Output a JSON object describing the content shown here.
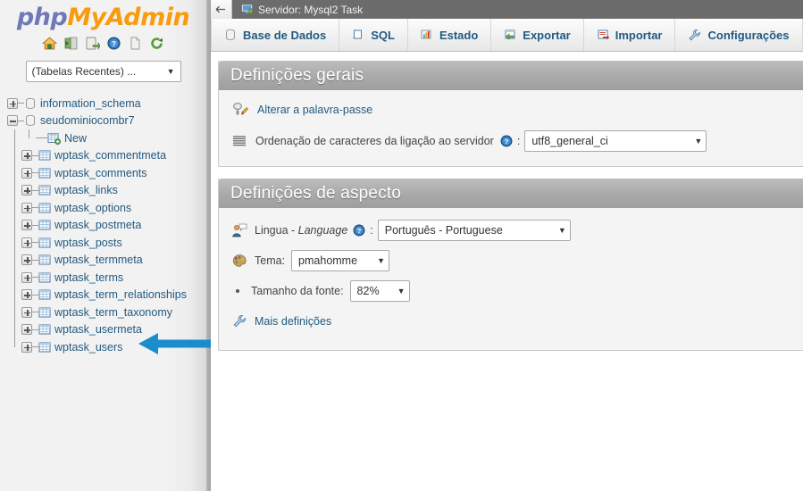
{
  "sidebar": {
    "logo": {
      "php": "php",
      "my": "My",
      "admin": "Admin"
    },
    "nav_icons": [
      {
        "name": "home-icon",
        "title": "Home"
      },
      {
        "name": "logout-icon",
        "title": "Log out"
      },
      {
        "name": "query-export-icon",
        "title": "Query"
      },
      {
        "name": "help-icon",
        "title": "Help"
      },
      {
        "name": "documentation-icon",
        "title": "Documentation"
      },
      {
        "name": "reload-icon",
        "title": "Reload"
      }
    ],
    "recent_select": {
      "value": "(Tabelas Recentes) ...",
      "arrow": "▼"
    },
    "tree": [
      {
        "label": "information_schema",
        "type": "database",
        "expanded": false
      },
      {
        "label": "seudominiocombr7",
        "type": "database",
        "expanded": true
      },
      {
        "label": "New",
        "type": "new-table"
      },
      {
        "label": "wptask_commentmeta",
        "type": "table"
      },
      {
        "label": "wptask_comments",
        "type": "table"
      },
      {
        "label": "wptask_links",
        "type": "table"
      },
      {
        "label": "wptask_options",
        "type": "table"
      },
      {
        "label": "wptask_postmeta",
        "type": "table"
      },
      {
        "label": "wptask_posts",
        "type": "table"
      },
      {
        "label": "wptask_termmeta",
        "type": "table"
      },
      {
        "label": "wptask_terms",
        "type": "table"
      },
      {
        "label": "wptask_term_relationships",
        "type": "table"
      },
      {
        "label": "wptask_term_taxonomy",
        "type": "table"
      },
      {
        "label": "wptask_usermeta",
        "type": "table"
      },
      {
        "label": "wptask_users",
        "type": "table"
      }
    ]
  },
  "annotation": {
    "arrow_color": "#1a8ecb",
    "points_to": "wptask_users"
  },
  "header": {
    "back_arrow": "←",
    "server_label": "Servidor: Mysql2 Task"
  },
  "tabs": [
    {
      "label": "Base de Dados",
      "icon": "database-icon"
    },
    {
      "label": "SQL",
      "icon": "sql-icon"
    },
    {
      "label": "Estado",
      "icon": "status-icon"
    },
    {
      "label": "Exportar",
      "icon": "export-icon"
    },
    {
      "label": "Importar",
      "icon": "import-icon"
    },
    {
      "label": "Configurações",
      "icon": "settings-wrench-icon"
    }
  ],
  "general_panel": {
    "title": "Definições gerais",
    "change_password_link": "Alterar a palavra-passe",
    "collation_label": "Ordenação de caracteres da ligação ao servidor",
    "collation_value": "utf8_general_ci",
    "colon": ":",
    "arrow": "▼"
  },
  "appearance_panel": {
    "title": "Definições de aspecto",
    "language_label_part1": "Lingua - ",
    "language_label_part2": "Language",
    "language_value": "Português - Portuguese",
    "theme_label": "Tema:",
    "theme_value": "pmahomme",
    "fontsize_label": "Tamanho da fonte:",
    "fontsize_value": "82%",
    "more_settings_link": "Mais definições",
    "colon": ":",
    "arrow": "▼"
  }
}
